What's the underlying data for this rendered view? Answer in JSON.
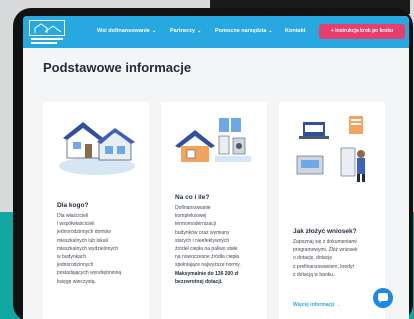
{
  "header": {
    "logo_icon": "house-logo-icon",
    "nav": [
      {
        "label": "Wsi dofinansowanie",
        "chevron": "⌄"
      },
      {
        "label": "Partnerzy",
        "chevron": "⌄"
      },
      {
        "label": "Pomocne narzędzia",
        "chevron": "⌄"
      },
      {
        "label": "Kontakt",
        "chevron": ""
      }
    ],
    "cta_label": "Instrukcja krok po kroku",
    "cta_icon": "plus-icon"
  },
  "main": {
    "title": "Podstawowe informacje"
  },
  "cards": [
    {
      "icon": "house-illustration-icon",
      "title": "Dla kogo?",
      "lines": [
        "Dla właścicieli",
        "i współwłaścicieli",
        "jednorodzinnych domów",
        "mieszkalnych lub lokali",
        "mieszkalnych wydzielonych",
        "w budynkach",
        "jednorodzinnych",
        "posiadających wyodrębnioną",
        "księgę wieczystą."
      ]
    },
    {
      "icon": "heating-devices-icon",
      "title": "Na co i ile?",
      "lines": [
        "Dofinansowanie",
        "kompleksowej",
        "termomodernizacji",
        "budynków oraz wymiany",
        "starych i nieefektywnych",
        "źródeł ciepła na paliwo stałe",
        "na nowoczesne źródła ciepła",
        "spełniające najwyższe normy.",
        "Maksymalnie do 136 200 zł",
        "bezzwrotnej dotacji."
      ]
    },
    {
      "icon": "online-application-icon",
      "title": "Jak złożyć wniosek?",
      "lines": [
        "Zapoznaj się z dokumentami",
        "programowymi. Złóż wniosek",
        "o dotację, dotację",
        "z prefinansowaniem, kredyt",
        "z dotacją w banku."
      ],
      "link": "Więcej informacji →"
    }
  ],
  "chat_icon": "chat-bubble-icon",
  "colors": {
    "header_bg": "#27a8e0",
    "cta_bg": "#e83e6c",
    "title": "#232b3a",
    "link": "#27a8e0",
    "page_bg": "#f4f5f7"
  }
}
